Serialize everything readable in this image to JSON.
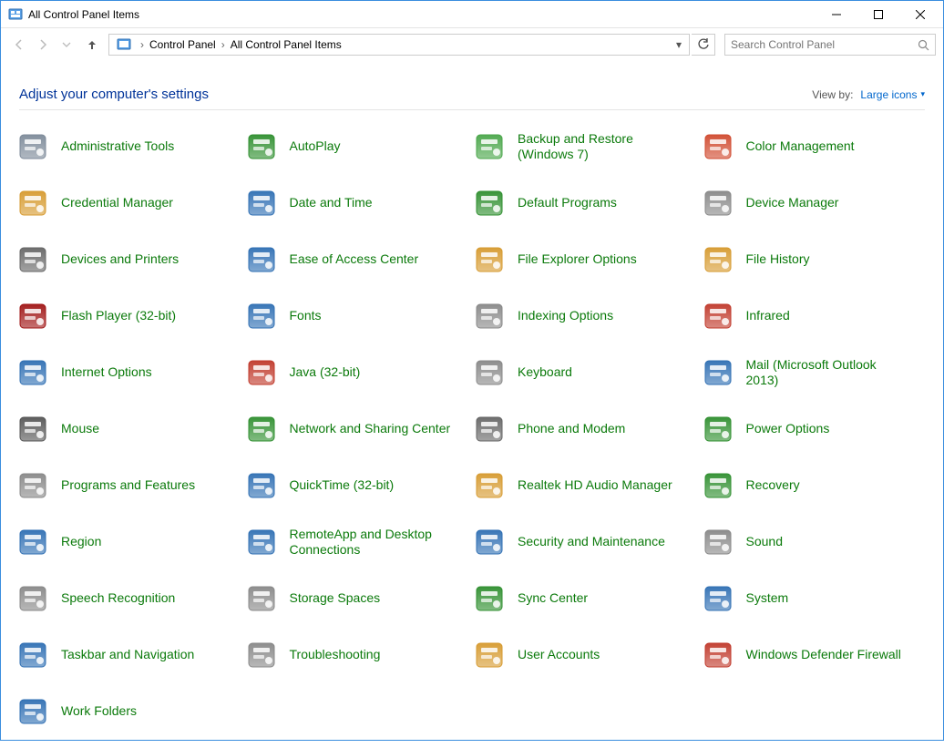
{
  "window": {
    "title": "All Control Panel Items"
  },
  "breadcrumbs": {
    "root": "Control Panel",
    "current": "All Control Panel Items"
  },
  "search": {
    "placeholder": "Search Control Panel"
  },
  "header": {
    "title": "Adjust your computer's settings"
  },
  "viewby": {
    "label": "View by:",
    "value": "Large icons"
  },
  "items": [
    {
      "label": "Administrative Tools",
      "icon": "admin-tools"
    },
    {
      "label": "AutoPlay",
      "icon": "autoplay"
    },
    {
      "label": "Backup and Restore (Windows 7)",
      "icon": "backup"
    },
    {
      "label": "Color Management",
      "icon": "color-mgmt"
    },
    {
      "label": "Credential Manager",
      "icon": "credential"
    },
    {
      "label": "Date and Time",
      "icon": "datetime"
    },
    {
      "label": "Default Programs",
      "icon": "default-programs"
    },
    {
      "label": "Device Manager",
      "icon": "device-manager"
    },
    {
      "label": "Devices and Printers",
      "icon": "devices-printers"
    },
    {
      "label": "Ease of Access Center",
      "icon": "ease-access"
    },
    {
      "label": "File Explorer Options",
      "icon": "file-explorer-options"
    },
    {
      "label": "File History",
      "icon": "file-history"
    },
    {
      "label": "Flash Player (32-bit)",
      "icon": "flash"
    },
    {
      "label": "Fonts",
      "icon": "fonts"
    },
    {
      "label": "Indexing Options",
      "icon": "indexing"
    },
    {
      "label": "Infrared",
      "icon": "infrared"
    },
    {
      "label": "Internet Options",
      "icon": "internet-options"
    },
    {
      "label": "Java (32-bit)",
      "icon": "java"
    },
    {
      "label": "Keyboard",
      "icon": "keyboard"
    },
    {
      "label": "Mail (Microsoft Outlook 2013)",
      "icon": "mail"
    },
    {
      "label": "Mouse",
      "icon": "mouse"
    },
    {
      "label": "Network and Sharing Center",
      "icon": "network"
    },
    {
      "label": "Phone and Modem",
      "icon": "phone-modem"
    },
    {
      "label": "Power Options",
      "icon": "power"
    },
    {
      "label": "Programs and Features",
      "icon": "programs"
    },
    {
      "label": "QuickTime (32-bit)",
      "icon": "quicktime"
    },
    {
      "label": "Realtek HD Audio Manager",
      "icon": "realtek"
    },
    {
      "label": "Recovery",
      "icon": "recovery"
    },
    {
      "label": "Region",
      "icon": "region"
    },
    {
      "label": "RemoteApp and Desktop Connections",
      "icon": "remoteapp"
    },
    {
      "label": "Security and Maintenance",
      "icon": "security"
    },
    {
      "label": "Sound",
      "icon": "sound"
    },
    {
      "label": "Speech Recognition",
      "icon": "speech"
    },
    {
      "label": "Storage Spaces",
      "icon": "storage"
    },
    {
      "label": "Sync Center",
      "icon": "sync"
    },
    {
      "label": "System",
      "icon": "system"
    },
    {
      "label": "Taskbar and Navigation",
      "icon": "taskbar"
    },
    {
      "label": "Troubleshooting",
      "icon": "troubleshoot"
    },
    {
      "label": "User Accounts",
      "icon": "user-accounts"
    },
    {
      "label": "Windows Defender Firewall",
      "icon": "firewall"
    },
    {
      "label": "Work Folders",
      "icon": "work-folders"
    }
  ],
  "iconColors": {
    "admin-tools": "#7d8a99",
    "autoplay": "#2f8f2f",
    "backup": "#4aa64a",
    "color-mgmt": "#d04a2f",
    "credential": "#d69a2f",
    "datetime": "#2f6fb3",
    "default-programs": "#2f8f2f",
    "device-manager": "#888",
    "devices-printers": "#666",
    "ease-access": "#2f6fb3",
    "file-explorer-options": "#d69a2f",
    "file-history": "#d69a2f",
    "flash": "#a01515",
    "fonts": "#2f6fb3",
    "indexing": "#888",
    "infrared": "#c0392b",
    "internet-options": "#2f6fb3",
    "java": "#c0392b",
    "keyboard": "#888",
    "mail": "#2f6fb3",
    "mouse": "#555",
    "network": "#2f8f2f",
    "phone-modem": "#666",
    "power": "#2f8f2f",
    "programs": "#888",
    "quicktime": "#2f6fb3",
    "realtek": "#d69a2f",
    "recovery": "#2f8f2f",
    "region": "#2f6fb3",
    "remoteapp": "#2f6fb3",
    "security": "#2f6fb3",
    "sound": "#888",
    "speech": "#888",
    "storage": "#888",
    "sync": "#2f8f2f",
    "system": "#2f6fb3",
    "taskbar": "#2f6fb3",
    "troubleshoot": "#888",
    "user-accounts": "#d69a2f",
    "firewall": "#c0392b",
    "work-folders": "#2f6fb3"
  }
}
